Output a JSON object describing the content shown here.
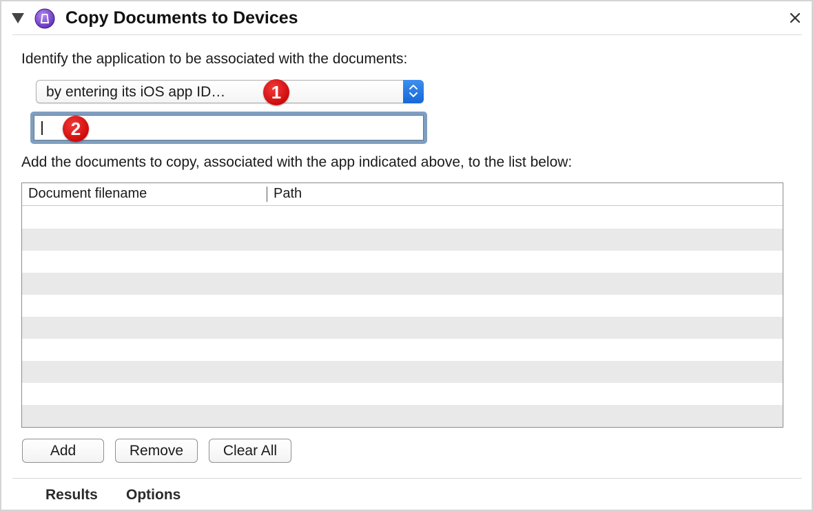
{
  "header": {
    "title": "Copy Documents to Devices",
    "disclosure_icon": "disclosure-triangle-down-icon",
    "app_icon": "app-icon",
    "close_icon": "close-icon"
  },
  "identify": {
    "label": "Identify the application to be associated with the documents:",
    "popup_value": "by entering its iOS app ID…",
    "app_id_value": ""
  },
  "documents": {
    "label": "Add the documents to copy, associated with the app indicated above, to the list below:",
    "columns": [
      "Document filename",
      "Path"
    ],
    "rows": []
  },
  "buttons": {
    "add": "Add",
    "remove": "Remove",
    "clear_all": "Clear All"
  },
  "footer": {
    "tabs": [
      "Results",
      "Options"
    ]
  },
  "badges": [
    "1",
    "2"
  ],
  "colors": {
    "badge_red": "#d81414",
    "stepper_blue": "#1f73e0",
    "focus_ring": "#7f9fc0",
    "alt_row": "#e9e9e9"
  }
}
